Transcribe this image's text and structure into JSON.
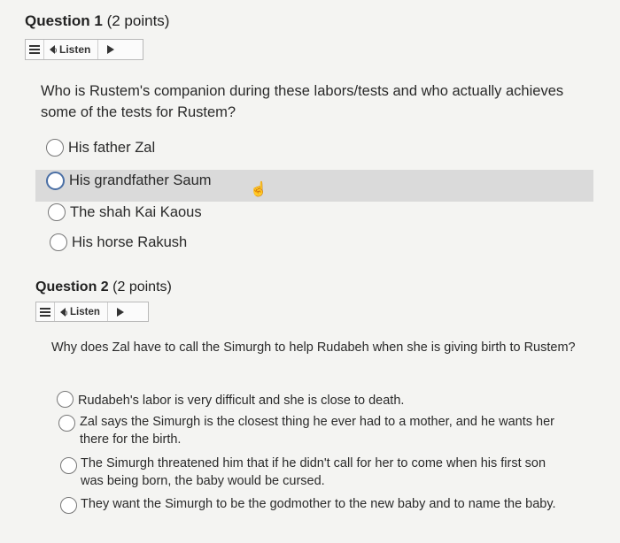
{
  "q1": {
    "title": "Question 1",
    "points": "(2 points)",
    "listen_label": "Listen",
    "text": "Who is Rustem's companion during these labors/tests and who actually achieves some of the tests for Rustem?",
    "options": [
      "His father Zal",
      "His grandfather Saum",
      "The shah Kai Kaous",
      "His horse Rakush"
    ],
    "highlighted_option_index": 1
  },
  "q2": {
    "title": "Question 2",
    "points": "(2 points)",
    "listen_label": "Listen",
    "text": "Why does Zal have to call the Simurgh to help Rudabeh when she is giving birth to Rustem?",
    "options": [
      "Rudabeh's labor is very difficult and she is close to death.",
      "Zal says the Simurgh is the closest thing he ever had to a mother, and he wants her there for the birth.",
      "The Simurgh threatened him that if he didn't call for her to come when his first son was being born, the baby would be cursed.",
      "They want the Simurgh to be the godmother to the new baby and to name the baby."
    ]
  },
  "colors": {
    "highlight": "#dadada",
    "radio_focus": "#4a6fa5"
  },
  "icons": [
    "menu-icon",
    "speaker-icon",
    "play-icon",
    "hand-cursor-icon"
  ]
}
